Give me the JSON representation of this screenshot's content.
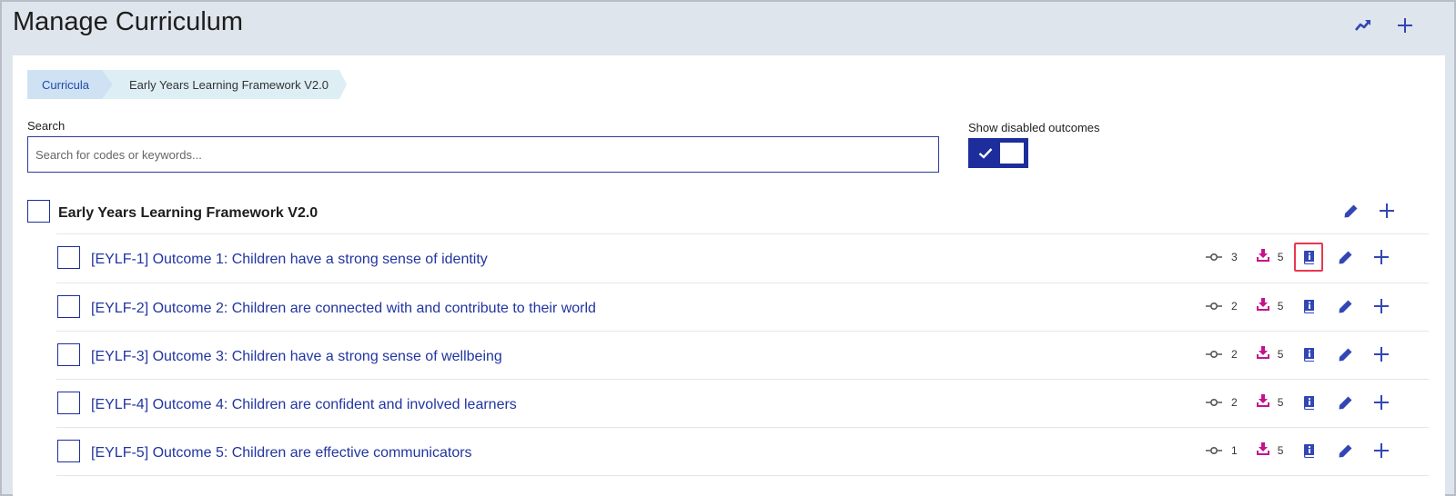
{
  "header": {
    "title": "Manage Curriculum"
  },
  "breadcrumb": {
    "items": [
      {
        "label": "Curricula"
      },
      {
        "label": "Early Years Learning Framework V2.0"
      }
    ]
  },
  "search": {
    "label": "Search",
    "placeholder": "Search for codes or keywords...",
    "value": ""
  },
  "toggle": {
    "label": "Show disabled outcomes",
    "checked": true
  },
  "curriculum": {
    "title": "Early Years Learning Framework V2.0",
    "outcomes": [
      {
        "label": "[EYLF-1] Outcome 1: Children have a strong sense of identity",
        "links": "3",
        "resources": "5",
        "selected_action": "details"
      },
      {
        "label": "[EYLF-2] Outcome 2: Children are connected with and contribute to their world",
        "links": "2",
        "resources": "5"
      },
      {
        "label": "[EYLF-3] Outcome 3: Children have a strong sense of wellbeing",
        "links": "2",
        "resources": "5"
      },
      {
        "label": "[EYLF-4] Outcome 4: Children are confident and involved learners",
        "links": "2",
        "resources": "5"
      },
      {
        "label": "[EYLF-5] Outcome 5: Children are effective communicators",
        "links": "1",
        "resources": "5"
      }
    ]
  },
  "icons": {
    "trend": "trend-up-icon",
    "add": "plus-icon",
    "edit": "pencil-icon",
    "link": "commit-node-icon",
    "resources": "download-tray-icon",
    "details": "book-info-icon",
    "check": "check-icon"
  },
  "colors": {
    "accent": "#1d2e9c",
    "icon_blue": "#3247b4",
    "resource_magenta": "#c4128e",
    "highlight_red": "#e8384f",
    "header_bg": "#dfe5ec"
  }
}
